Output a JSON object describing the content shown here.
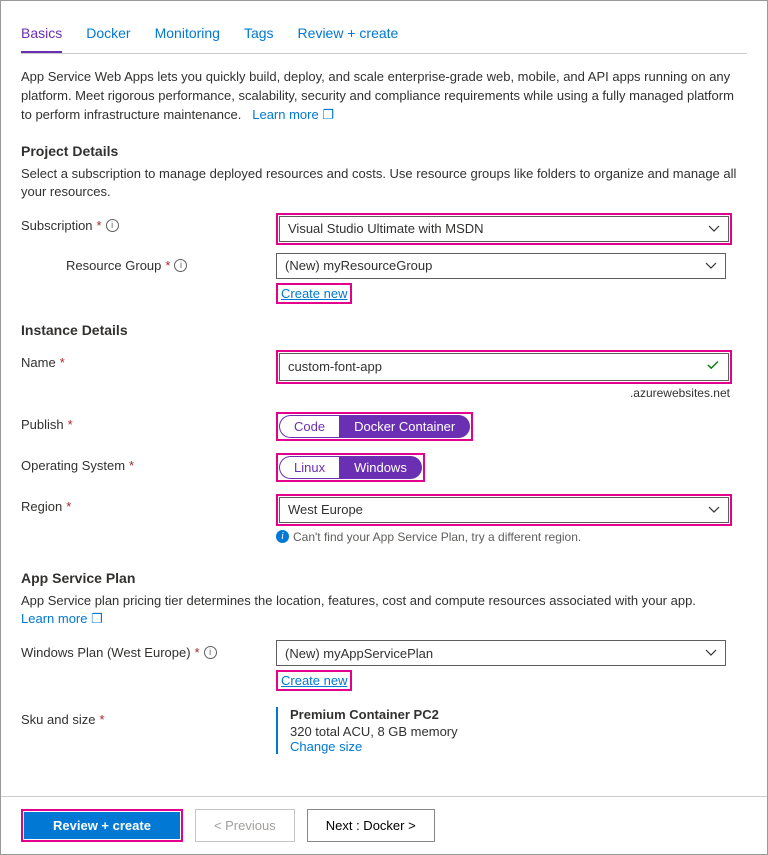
{
  "tabs": {
    "basics": "Basics",
    "docker": "Docker",
    "monitoring": "Monitoring",
    "tags": "Tags",
    "review": "Review + create"
  },
  "intro": {
    "text": "App Service Web Apps lets you quickly build, deploy, and scale enterprise-grade web, mobile, and API apps running on any platform. Meet rigorous performance, scalability, security and compliance requirements while using a fully managed platform to perform infrastructure maintenance.",
    "learn": "Learn more"
  },
  "project": {
    "heading": "Project Details",
    "desc": "Select a subscription to manage deployed resources and costs. Use resource groups like folders to organize and manage all your resources.",
    "subscription_label": "Subscription",
    "subscription_value": "Visual Studio Ultimate with MSDN",
    "rg_label": "Resource Group",
    "rg_value": "(New) myResourceGroup",
    "create_new": "Create new"
  },
  "instance": {
    "heading": "Instance Details",
    "name_label": "Name",
    "name_value": "custom-font-app",
    "suffix": ".azurewebsites.net",
    "publish_label": "Publish",
    "publish_code": "Code",
    "publish_docker": "Docker Container",
    "os_label": "Operating System",
    "os_linux": "Linux",
    "os_windows": "Windows",
    "region_label": "Region",
    "region_value": "West Europe",
    "region_hint": "Can't find your App Service Plan, try a different region."
  },
  "plan": {
    "heading": "App Service Plan",
    "desc": "App Service plan pricing tier determines the location, features, cost and compute resources associated with your app.",
    "learn": "Learn more",
    "win_label": "Windows Plan (West Europe)",
    "win_value": "(New) myAppServicePlan",
    "create_new": "Create new",
    "sku_label": "Sku and size",
    "sku_name": "Premium Container PC2",
    "sku_detail": "320 total ACU, 8 GB memory",
    "change": "Change size"
  },
  "footer": {
    "review": "Review + create",
    "prev": "< Previous",
    "next": "Next : Docker >"
  }
}
